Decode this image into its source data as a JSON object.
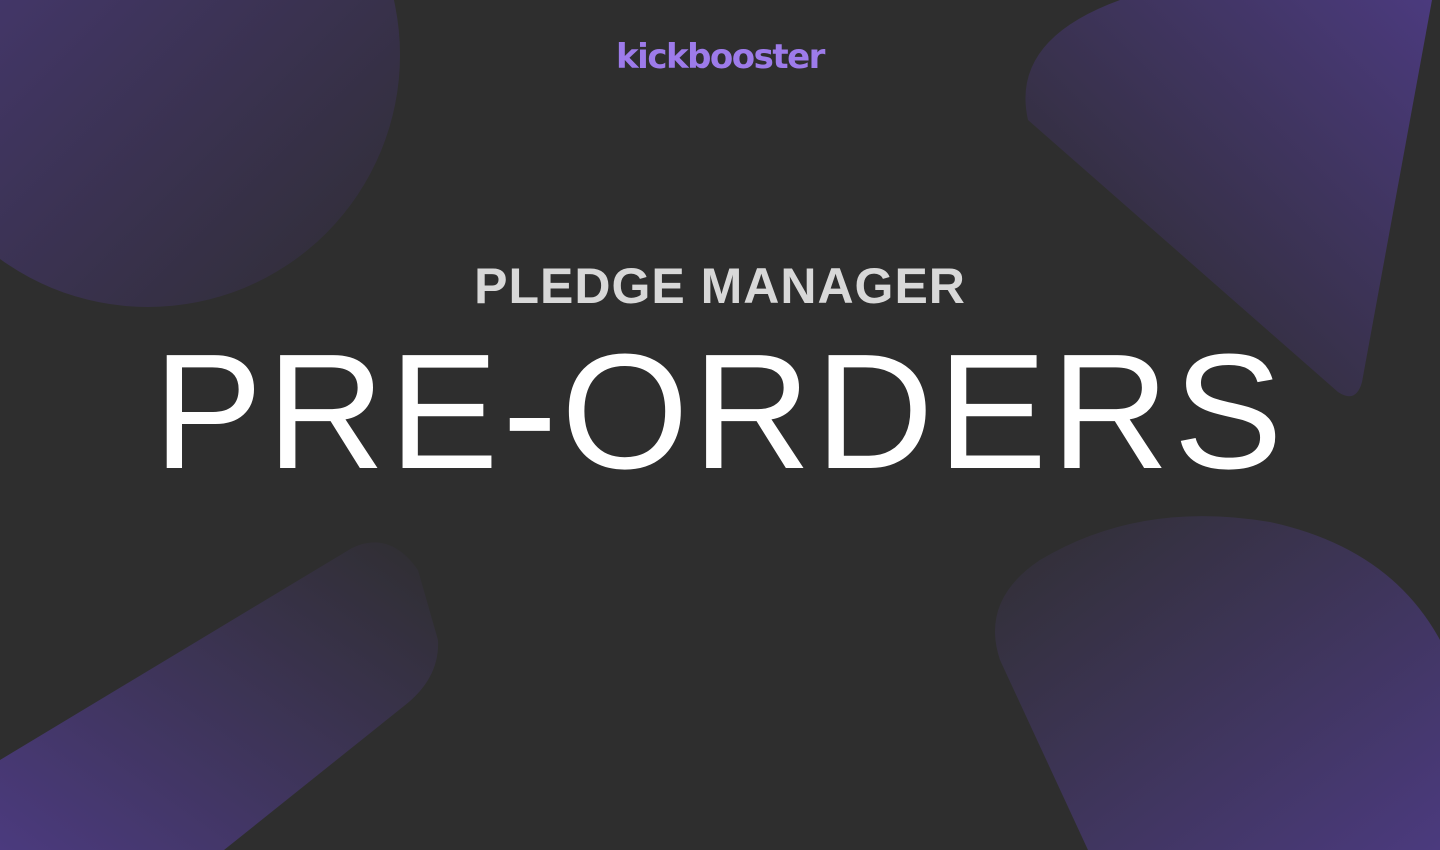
{
  "brand": {
    "logo_text": "kickbooster"
  },
  "hero": {
    "subtitle": "PLEDGE MANAGER",
    "title": "PRE-ORDERS"
  },
  "colors": {
    "background": "#2e2e2e",
    "accent": "#9d7bea",
    "shape_purple": "#4b3a7e",
    "subtitle_text": "#d8d8d8",
    "title_text": "#ffffff"
  }
}
